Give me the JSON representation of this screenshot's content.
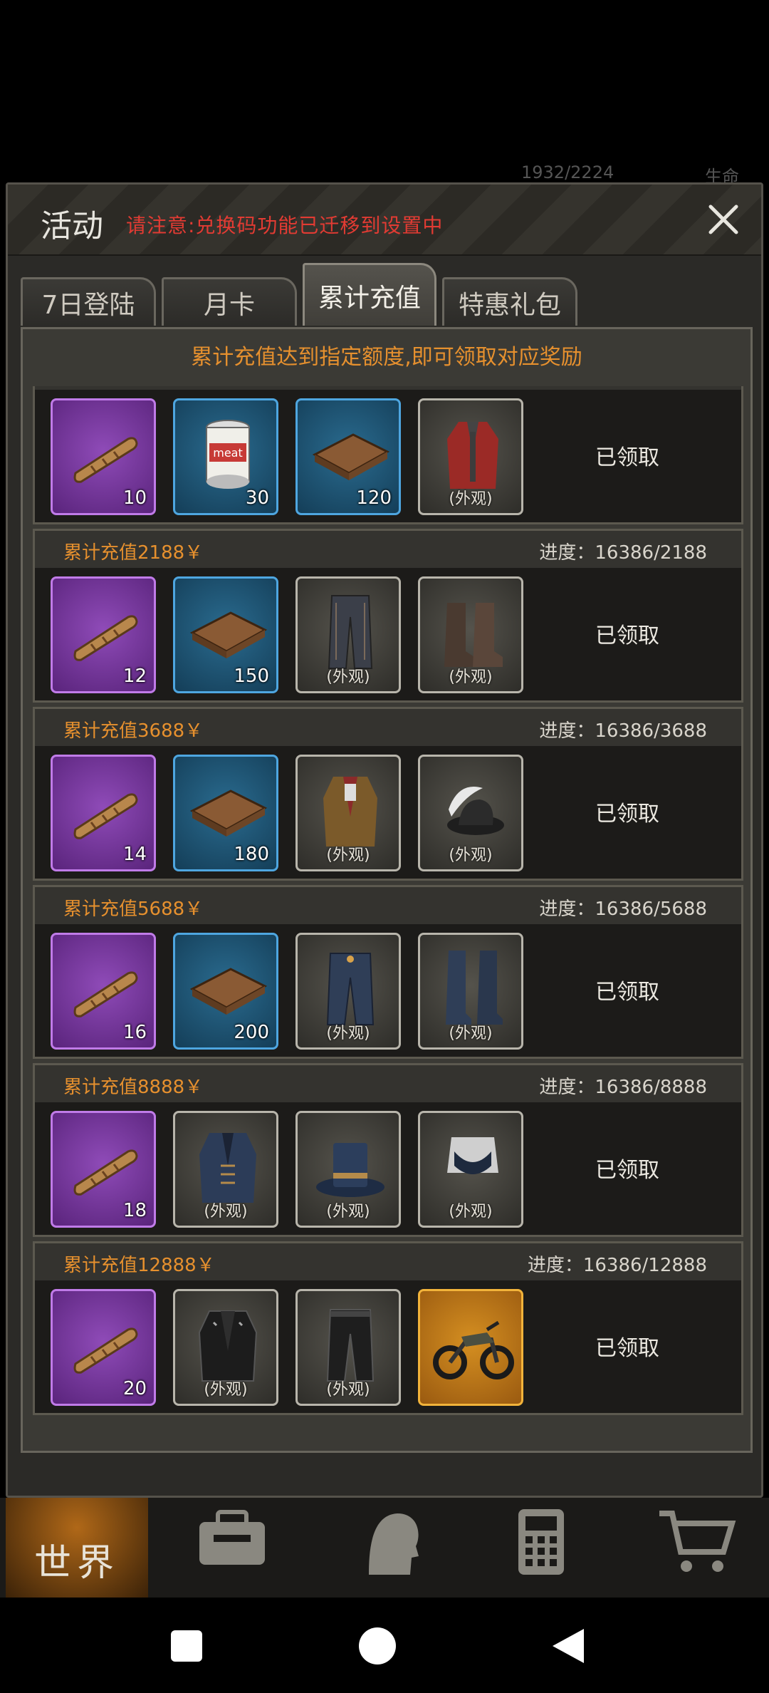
{
  "hud": {
    "hp": "1932/2224",
    "life_label": "生命"
  },
  "dialog": {
    "title": "活动",
    "notice": "请注意:兑换码功能已迁移到设置中"
  },
  "tabs": [
    {
      "label": "7日登陆",
      "active": false
    },
    {
      "label": "月卡",
      "active": false
    },
    {
      "label": "累计充值",
      "active": true
    },
    {
      "label": "特惠礼包",
      "active": false
    }
  ],
  "panel_hint": "累计充值达到指定额度,即可领取对应奖励",
  "tiers": [
    {
      "title": "",
      "progress": "",
      "status": "已领取",
      "items": [
        {
          "kind": "purple",
          "icon": "cigar-icon",
          "qty": "10",
          "tag": ""
        },
        {
          "kind": "blue",
          "icon": "meat-can-icon",
          "qty": "30",
          "tag": ""
        },
        {
          "kind": "blue",
          "icon": "book-icon",
          "qty": "120",
          "tag": ""
        },
        {
          "kind": "grey",
          "icon": "red-coat-icon",
          "qty": "",
          "tag": "(外观)"
        }
      ]
    },
    {
      "title": "累计充值2188￥",
      "progress": "进度：16386/2188",
      "status": "已领取",
      "items": [
        {
          "kind": "purple",
          "icon": "cigar-icon",
          "qty": "12",
          "tag": ""
        },
        {
          "kind": "blue",
          "icon": "book-icon",
          "qty": "150",
          "tag": ""
        },
        {
          "kind": "grey",
          "icon": "pants-icon",
          "qty": "",
          "tag": "(外观)"
        },
        {
          "kind": "grey",
          "icon": "boots-icon",
          "qty": "",
          "tag": "(外观)"
        }
      ]
    },
    {
      "title": "累计充值3688￥",
      "progress": "进度：16386/3688",
      "status": "已领取",
      "items": [
        {
          "kind": "purple",
          "icon": "cigar-icon",
          "qty": "14",
          "tag": ""
        },
        {
          "kind": "blue",
          "icon": "book-icon",
          "qty": "180",
          "tag": ""
        },
        {
          "kind": "grey",
          "icon": "jacket-icon",
          "qty": "",
          "tag": "(外观)"
        },
        {
          "kind": "grey",
          "icon": "feather-hat-icon",
          "qty": "",
          "tag": "(外观)"
        }
      ]
    },
    {
      "title": "累计充值5688￥",
      "progress": "进度：16386/5688",
      "status": "已领取",
      "items": [
        {
          "kind": "purple",
          "icon": "cigar-icon",
          "qty": "16",
          "tag": ""
        },
        {
          "kind": "blue",
          "icon": "book-icon",
          "qty": "200",
          "tag": ""
        },
        {
          "kind": "grey",
          "icon": "jeans-icon",
          "qty": "",
          "tag": "(外观)"
        },
        {
          "kind": "grey",
          "icon": "tall-boots-icon",
          "qty": "",
          "tag": "(外观)"
        }
      ]
    },
    {
      "title": "累计充值8888￥",
      "progress": "进度：16386/8888",
      "status": "已领取",
      "items": [
        {
          "kind": "purple",
          "icon": "cigar-icon",
          "qty": "18",
          "tag": ""
        },
        {
          "kind": "grey",
          "icon": "blue-jacket-icon",
          "qty": "",
          "tag": "(外观)"
        },
        {
          "kind": "grey",
          "icon": "top-hat-icon",
          "qty": "",
          "tag": "(外观)"
        },
        {
          "kind": "grey",
          "icon": "top-outfit-icon",
          "qty": "",
          "tag": "(外观)"
        }
      ]
    },
    {
      "title": "累计充值12888￥",
      "progress": "进度：16386/12888",
      "status": "已领取",
      "items": [
        {
          "kind": "purple",
          "icon": "cigar-icon",
          "qty": "20",
          "tag": ""
        },
        {
          "kind": "grey",
          "icon": "leather-jacket-icon",
          "qty": "",
          "tag": "(外观)"
        },
        {
          "kind": "grey",
          "icon": "leather-pants-icon",
          "qty": "",
          "tag": "(外观)"
        },
        {
          "kind": "gold",
          "icon": "motorcycle-icon",
          "qty": "",
          "tag": ""
        }
      ]
    }
  ],
  "game_nav": {
    "world_label": "世界"
  },
  "colors": {
    "accent_orange": "#e6902e",
    "notice_red": "#e23b33",
    "purple": "#8f4bb8",
    "blue": "#2a6b8f",
    "gold": "#d58f21"
  }
}
